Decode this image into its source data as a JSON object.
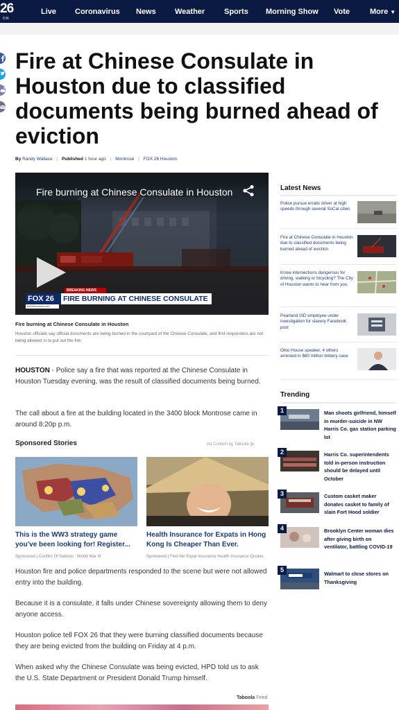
{
  "colors": {
    "nav_bg": "#0b1a43",
    "link": "#1d3a7a",
    "fox_blue": "#0d2a6c",
    "breaking_red": "#bb0000"
  },
  "nav": {
    "logo_number": "26",
    "logo_sub": "ON",
    "items": [
      "Live",
      "Coronavirus",
      "News",
      "Weather",
      "Sports",
      "Morning Show",
      "Vote",
      "More"
    ],
    "more_icon": "chevron-down-icon"
  },
  "social_icons": [
    "facebook-icon",
    "twitter-icon",
    "reddit-icon",
    "email-icon"
  ],
  "article": {
    "headline": "Fire at Chinese Consulate in Houston due to classified documents being burned ahead of eviction",
    "byline": {
      "by_label": "By",
      "author": "Randy Wallace",
      "published_label": "Published",
      "published_time": "1 hour ago",
      "tag": "Montrose",
      "source": "FOX 26 Houston"
    },
    "video": {
      "title": "Fire burning at Chinese Consulate in Houston",
      "breaking_label": "BREAKING NEWS",
      "station": "FOX 26",
      "chyron": "FIRE BURNING AT CHINESE CONSULATE",
      "station_url": "fox26houston.com"
    },
    "caption": {
      "title": "Fire burning at Chinese Consulate in Houston",
      "text": "Houston officials say official documents are being burned in the courtyard of the Chinese Consulate, and first responders are not being allowed in to put out the fire."
    },
    "dateline": "HOUSTON",
    "p1_rest": " - Police say a fire that was reported at the Chinese Consulate in Houston Tuesday evening, was the result of classified documents being burned.",
    "p2": "The call about a fire at the building located in the 3400 block Montrose came in around 8:20p p.m.",
    "p3": "Houston fire and police departments responded to the scene but were not allowed entry into the building.",
    "p4": "Because it is a consulate, it falls under Chinese sovereignty allowing them to deny anyone access.",
    "p5": "Houston police tell FOX 26 that they were burning classified documents because they are being evicted from the building on Friday at 4 p.m.",
    "p6": "When asked why the Chinese Consulate was being evicted, HPD told us to ask the U.S. State Department or President Donald Trump himself."
  },
  "sponsored": {
    "label": "Sponsored Stories",
    "ad_content": "Ad Content by Taboola",
    "cards": [
      {
        "title": "This is the WW3 strategy game you've been looking for! Register...",
        "meta": "Sponsored | Conflict Of Nations : World War III"
      },
      {
        "title": "Health Insurance for Expats in Hong Kong Is Cheaper Than Ever.",
        "meta": "Sponsored | Find Me Expat Insurance Health Insurance Quotes"
      }
    ],
    "taboola_brand": "Taboola",
    "taboola_feed": "Feed"
  },
  "latest_news": {
    "heading": "Latest News",
    "items": [
      "Police pursue erratic driver at high speeds through several SoCal cities",
      "Fire at Chinese Consulate in Houston due to classified documents being burned ahead of eviction",
      "Know intersections dangerous for driving, walking or bicycling? The City of Houston wants to hear from you",
      "Pearland ISD employee under investigation for slavery Facebook post",
      "Ohio House speaker, 4 others arrested in $60 million bribery case"
    ]
  },
  "trending": {
    "heading": "Trending",
    "items": [
      {
        "num": "1",
        "text": "Man shoots girlfriend, himself in murder-suicide in NW Harris Co. gas station parking lot"
      },
      {
        "num": "2",
        "text": "Harris Co. superintendents told in-person instruction should be delayed until October"
      },
      {
        "num": "3",
        "text": "Custom casket maker donates casket to family of slain Fort Hood soldier"
      },
      {
        "num": "4",
        "text": "Brooklyn Center woman dies after giving birth on ventilator, battling COVID-19"
      },
      {
        "num": "5",
        "text": "Walmart to close stores on Thanksgiving"
      }
    ]
  }
}
